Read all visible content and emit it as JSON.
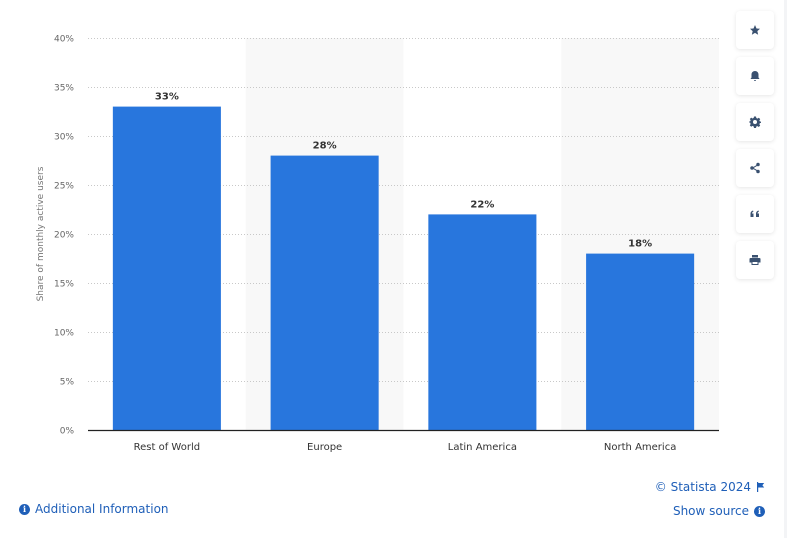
{
  "chart_data": {
    "type": "bar",
    "title": "",
    "xlabel": "",
    "ylabel": "Share of monthly active users",
    "categories": [
      "Rest of World",
      "Europe",
      "Latin America",
      "North America"
    ],
    "values": [
      33,
      28,
      22,
      18
    ],
    "data_labels": [
      "33%",
      "28%",
      "22%",
      "18%"
    ],
    "ylim": [
      0,
      40
    ],
    "yticks": [
      0,
      5,
      10,
      15,
      20,
      25,
      30,
      35,
      40
    ],
    "ytick_labels": [
      "0%",
      "5%",
      "10%",
      "15%",
      "20%",
      "25%",
      "30%",
      "35%",
      "40%"
    ],
    "grid": true,
    "bar_color": "#2876dd",
    "legend": "none"
  },
  "sidebar": {
    "buttons": [
      {
        "name": "favorite-button",
        "icon": "star-icon"
      },
      {
        "name": "notification-button",
        "icon": "bell-icon"
      },
      {
        "name": "settings-button",
        "icon": "gear-icon"
      },
      {
        "name": "share-button",
        "icon": "share-icon"
      },
      {
        "name": "cite-button",
        "icon": "quote-icon"
      },
      {
        "name": "print-button",
        "icon": "print-icon"
      }
    ]
  },
  "footer": {
    "additional_info": "Additional Information",
    "copyright": "© Statista 2024",
    "show_source": "Show source"
  }
}
